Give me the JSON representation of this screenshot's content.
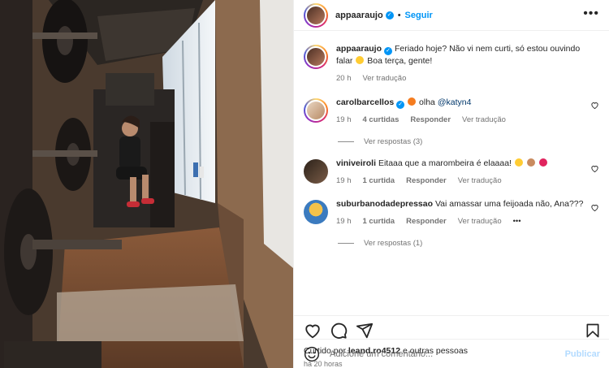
{
  "post": {
    "author": "appaaraujo",
    "follow_label": "Seguir",
    "more_label": "•••",
    "caption_text": "Feriado hoje? Não vi nem curti, só estou ouvindo falar",
    "caption_end": "Boa terça, gente!",
    "caption_time": "20 h",
    "caption_translate": "Ver tradução"
  },
  "comments": [
    {
      "user": "carolbarcellos",
      "verified": true,
      "text_prefix": "olha",
      "mention": "@katyn4",
      "time": "19 h",
      "likes": "4 curtidas",
      "reply": "Responder",
      "translate": "Ver tradução",
      "replies": "Ver respostas (3)"
    },
    {
      "user": "viniveiroli",
      "verified": false,
      "text": "Eitaaa que a marombeira é elaaaa!",
      "time": "19 h",
      "likes": "1 curtida",
      "reply": "Responder",
      "translate": "Ver tradução"
    },
    {
      "user": "suburbanodadepressao",
      "verified": false,
      "text": "Vai amassar uma feijoada não, Ana???",
      "time": "19 h",
      "likes": "1 curtida",
      "reply": "Responder",
      "translate": "Ver tradução",
      "more": "•••",
      "replies": "Ver respostas (1)"
    }
  ],
  "likes": {
    "prefix": "Curtido por",
    "user": "leand.ro4512",
    "suffix": "e outras pessoas"
  },
  "posted_ago": "há 20 horas",
  "add_comment": {
    "placeholder": "Adicione um comentário...",
    "publish": "Publicar"
  },
  "icons": [
    "heart-icon",
    "comment-icon",
    "share-icon",
    "bookmark-icon",
    "emoji-icon",
    "verified-icon",
    "more-icon"
  ],
  "colors": {
    "accent": "#0095f6",
    "publish_disabled": "#b3dbff",
    "muted": "#737373"
  }
}
